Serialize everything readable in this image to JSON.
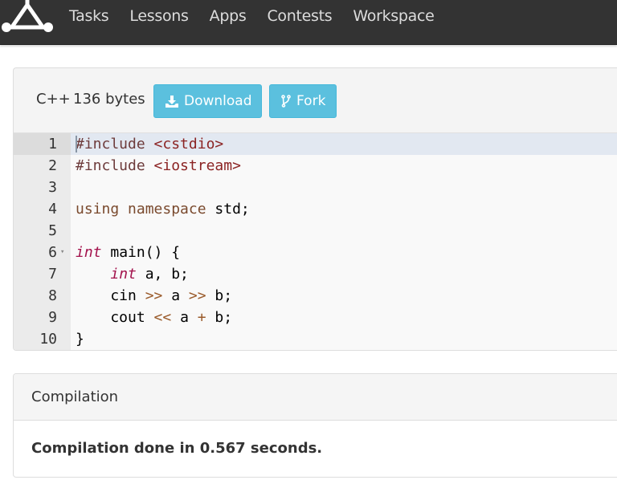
{
  "navbar": {
    "logo": "app-logo",
    "items": [
      {
        "label": "Tasks"
      },
      {
        "label": "Lessons"
      },
      {
        "label": "Apps"
      },
      {
        "label": "Contests"
      },
      {
        "label": "Workspace"
      }
    ]
  },
  "code": {
    "language": "C++",
    "size": "136 bytes",
    "download_label": "Download",
    "download_icon": "download-icon",
    "fork_label": "Fork",
    "fork_icon": "fork-icon",
    "active_line": 1,
    "lines": [
      {
        "n": "1",
        "tokens": [
          {
            "t": "#include ",
            "c": "pre"
          },
          {
            "t": "<cstdio>",
            "c": "str"
          }
        ]
      },
      {
        "n": "2",
        "tokens": [
          {
            "t": "#include ",
            "c": "pre"
          },
          {
            "t": "<iostream>",
            "c": "str"
          }
        ]
      },
      {
        "n": "3",
        "tokens": []
      },
      {
        "n": "4",
        "tokens": [
          {
            "t": "using namespace ",
            "c": "kw"
          },
          {
            "t": "std;",
            "c": ""
          }
        ]
      },
      {
        "n": "5",
        "tokens": []
      },
      {
        "n": "6",
        "fold": true,
        "tokens": [
          {
            "t": "int",
            "c": "type"
          },
          {
            "t": " main() {",
            "c": ""
          }
        ]
      },
      {
        "n": "7",
        "tokens": [
          {
            "t": "    ",
            "c": ""
          },
          {
            "t": "int",
            "c": "type"
          },
          {
            "t": " a, b;",
            "c": ""
          }
        ]
      },
      {
        "n": "8",
        "tokens": [
          {
            "t": "    cin ",
            "c": ""
          },
          {
            "t": ">>",
            "c": "op"
          },
          {
            "t": " a ",
            "c": ""
          },
          {
            "t": ">>",
            "c": "op"
          },
          {
            "t": " b;",
            "c": ""
          }
        ]
      },
      {
        "n": "9",
        "tokens": [
          {
            "t": "    cout ",
            "c": ""
          },
          {
            "t": "<<",
            "c": "op"
          },
          {
            "t": " a ",
            "c": ""
          },
          {
            "t": "+",
            "c": "op"
          },
          {
            "t": " b;",
            "c": ""
          }
        ]
      },
      {
        "n": "10",
        "tokens": [
          {
            "t": "}",
            "c": ""
          }
        ]
      }
    ]
  },
  "compilation": {
    "title": "Compilation",
    "message": "Compilation done in 0.567 seconds."
  }
}
